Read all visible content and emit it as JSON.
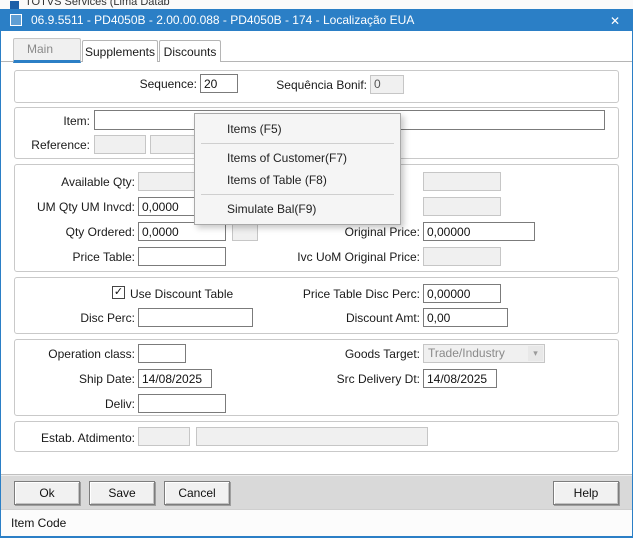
{
  "colors": {
    "accent": "#2b7fc6"
  },
  "icons": {
    "close": "✕",
    "check": "✓",
    "dropdown": "▾"
  },
  "background_window": {
    "title": "TOTVS Services (Lima Datab"
  },
  "titlebar": {
    "title": "06.9.5511 - PD4050B - 2.00.00.088 - PD4050B - 174 - Localização EUA"
  },
  "tabs": {
    "main": "Main",
    "supplements": "Supplements",
    "discounts": "Discounts"
  },
  "fields": {
    "sequence_label": "Sequence:",
    "sequence_value": "20",
    "bonif_label": "Sequência Bonif:",
    "bonif_value": "0",
    "item_label": "Item:",
    "item_value": "",
    "reference_label": "Reference:",
    "available_label": "Available Qty:",
    "um_label": "UM Qty UM Invcd:",
    "um_value": "0,0000",
    "ordered_label": "Qty Ordered:",
    "ordered_value": "0,0000",
    "price_table_label": "Price Table:",
    "price_table_value": "",
    "original_price_label": "Original Price:",
    "original_price_value": "0,00000",
    "ivc_label": "Ivc UoM Original Price:",
    "use_discount_label": "Use Discount Table",
    "use_discount_checked": true,
    "ptdp_label": "Price Table Disc Perc:",
    "ptdp_value": "0,00000",
    "disc_perc_label": "Disc Perc:",
    "disc_perc_value": "",
    "discount_amt_label": "Discount Amt:",
    "discount_amt_value": "0,00",
    "operation_class_label": "Operation class:",
    "operation_class_value": "",
    "goods_label": "Goods Target:",
    "goods_value": "Trade/Industry",
    "ship_label": "Ship Date:",
    "ship_value": "14/08/2025",
    "src_label": "Src Delivery Dt:",
    "src_value": "14/08/2025",
    "deliv_label": "Deliv:",
    "deliv_value": "",
    "estab_label": "Estab. Atdimento:"
  },
  "context_menu": {
    "items": [
      "Items (F5)",
      "Items of Customer(F7)",
      "Items of Table  (F8)",
      "Simulate Bal(F9)"
    ]
  },
  "buttons": {
    "ok": "Ok",
    "save": "Save",
    "cancel": "Cancel",
    "help": "Help"
  },
  "statusbar": {
    "text": "Item Code"
  }
}
